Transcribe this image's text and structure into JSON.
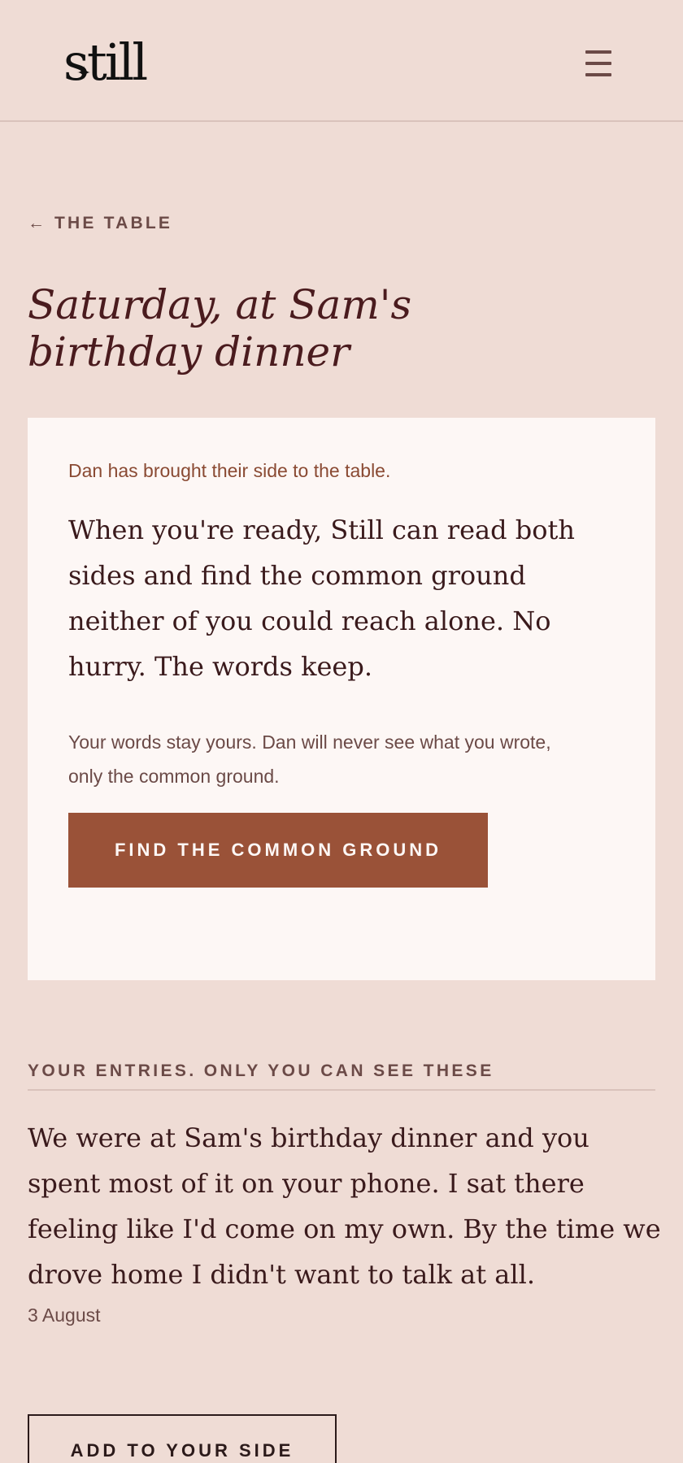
{
  "header": {
    "logo": "still",
    "menu_icon": "hamburger-menu-icon"
  },
  "nav": {
    "back_arrow": "←",
    "back_label": "THE TABLE"
  },
  "page": {
    "title_line1": "Saturday, at Sam's",
    "title_line2": "birthday dinner"
  },
  "card": {
    "status": "Dan has brought their side to the table.",
    "body": "When you're ready, Still can read both sides and find the common ground neither of you could reach alone. No hurry. The words keep.",
    "note": "Your words stay yours. Dan will never see what you wrote, only the common ground.",
    "button_label": "FIND THE COMMON GROUND"
  },
  "entries": {
    "heading": "YOUR ENTRIES. ONLY YOU CAN SEE THESE",
    "items": [
      {
        "text": "We were at Sam's birthday dinner and you spent most of it on your phone. I sat there feeling like I'd come on my own. By the time we drove home I didn't want to talk at all.",
        "date": "3 August"
      }
    ]
  },
  "actions": {
    "add_label": "ADD TO YOUR SIDE"
  },
  "colors": {
    "background": "#efdcd5",
    "card": "#fdf7f5",
    "accent": "#9a5238",
    "title": "#4a1b1e",
    "muted": "#6b4a47"
  }
}
